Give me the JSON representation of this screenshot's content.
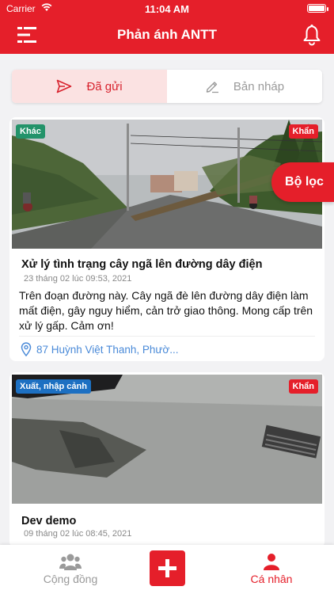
{
  "status_bar": {
    "carrier": "Carrier",
    "time": "11:04 AM"
  },
  "header": {
    "title": "Phản ánh ANTT",
    "menu_icon": "menu-icon",
    "bell_icon": "bell-icon"
  },
  "tabs": [
    {
      "label": "Đã gửi",
      "icon": "send-icon",
      "selected": true
    },
    {
      "label": "Bản nháp",
      "icon": "edit-icon",
      "selected": false
    }
  ],
  "filter_button": {
    "label": "Bộ lọc"
  },
  "reports": [
    {
      "category": "Khác",
      "category_color": "#23936a",
      "urgency": "Khẩn",
      "title": "Xử lý tình trạng cây ngã lên đường dây điện",
      "date": "23 tháng 02 lúc 09:53, 2021",
      "description": "Trên đoạn đường này. Cây ngã đè lên đường dây điện làm mất điện, gây nguy hiểm, cản trở giao thông. Mong cấp trên xử lý gấp. Cảm ơn!",
      "address": "87 Huỳnh Việt Thanh, Phườ..."
    },
    {
      "category": "Xuất, nhập cảnh",
      "category_color": "#1d70c2",
      "urgency": "Khẩn",
      "title": "Dev demo",
      "date": "09 tháng 02 lúc 08:45, 2021"
    }
  ],
  "bottom_nav": {
    "community": "Cộng đồng",
    "profile": "Cá nhân",
    "add_icon": "plus-icon"
  },
  "colors": {
    "primary": "#e51f2a",
    "link": "#4a8ad8"
  }
}
